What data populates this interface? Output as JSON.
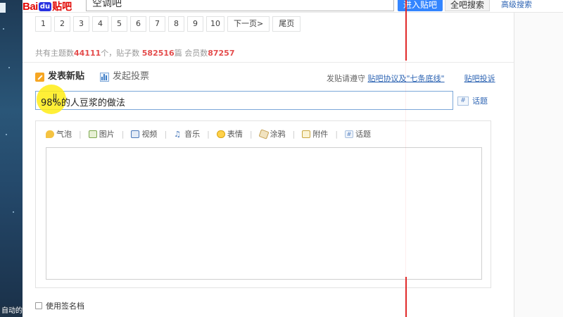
{
  "header": {
    "logo_bai": "Bai",
    "logo_du": "du",
    "logo_tieba": "贴吧",
    "search_value": "空调吧",
    "enter_button": "进入贴吧",
    "all_search_button": "全吧搜索",
    "advanced_search": "高级搜索"
  },
  "pagination": {
    "pages": [
      "1",
      "2",
      "3",
      "4",
      "5",
      "6",
      "7",
      "8",
      "9",
      "10"
    ],
    "next": "下一页>",
    "last": "尾页"
  },
  "stats": {
    "topics_label": "共有主题数",
    "topics": "44111",
    "topics_unit": "个，贴子数",
    "posts": "582516",
    "posts_unit": "篇 会员数",
    "members": "87257"
  },
  "compose": {
    "tab_new_post": "发表新贴",
    "tab_new_vote": "发起投票",
    "notice_prefix": "发贴请遵守",
    "notice_link": "贴吧协议及\"七条底线\"",
    "complaint_link": "贴吧投诉",
    "title_value": "98%的人豆浆的做法",
    "topic_label": "话题",
    "topic_hash": "#"
  },
  "toolbar": {
    "items": [
      "气泡",
      "图片",
      "视频",
      "音乐",
      "表情",
      "涂鸦",
      "附件",
      "话题"
    ]
  },
  "signature": {
    "label": "使用签名档"
  },
  "desktop": {
    "bottom_text": "自动的"
  },
  "colors": {
    "accent_red": "#e10602",
    "brand_blue": "#3385ff",
    "link_blue": "#2d64b3",
    "stat_red": "#e44c4c",
    "cursor_highlight": "#ffec14",
    "guide_line": "#e12a2a"
  }
}
